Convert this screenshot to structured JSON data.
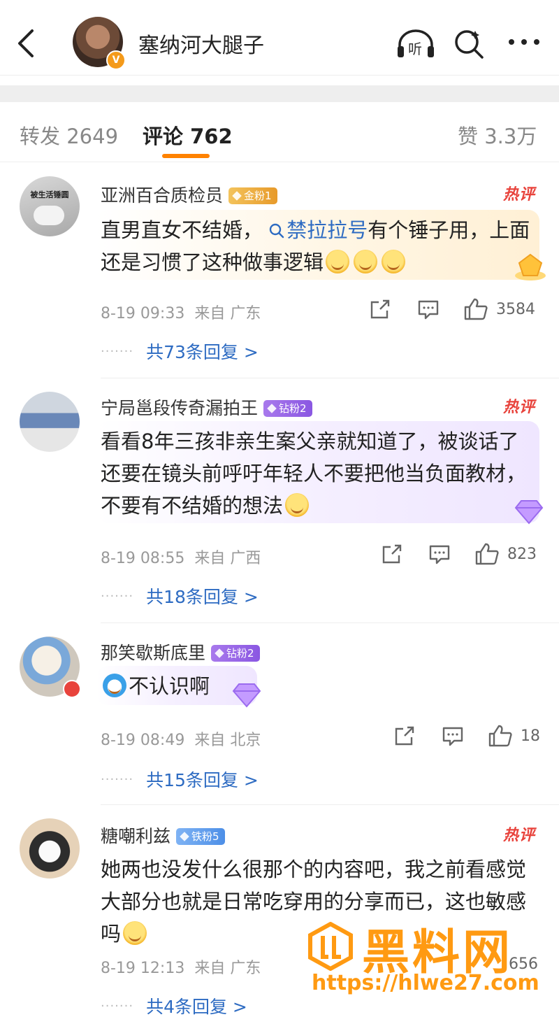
{
  "header": {
    "title": "塞纳河大腿子",
    "verified_badge": "V",
    "listen_label": "听",
    "icons": [
      "back-arrow-icon",
      "headphone-icon",
      "search-icon",
      "more-icon"
    ]
  },
  "tabs": [
    {
      "label": "转发 2649",
      "active": false
    },
    {
      "label": "评论 762",
      "active": true
    },
    {
      "label": "赞 3.3万",
      "active": false
    }
  ],
  "comments": [
    {
      "user": "亚洲百合质检员",
      "fan_badge": "金粉1",
      "fan_type": "gold",
      "hot_label": "热评",
      "avatar_caption": "被生活锤圆",
      "text_before": "直男直女不结婚，",
      "link": "禁拉拉号",
      "text_after": "有个锤子用，上面还是习惯了这种做事逻辑",
      "time": "8-19 09:33",
      "from": "来自 广东",
      "likes": "3584",
      "replies": "共73条回复 >"
    },
    {
      "user": "宁局邕段传奇漏拍王",
      "fan_badge": "钻粉2",
      "fan_type": "diamond",
      "hot_label": "热评",
      "text": "看看8年三孩非亲生案父亲就知道了，被谈话了还要在镜头前呼吁年轻人不要把他当负面教材，不要有不结婚的想法",
      "time": "8-19 08:55",
      "from": "来自 广西",
      "likes": "823",
      "replies": "共18条回复 >"
    },
    {
      "user": "那笑歇斯底里",
      "fan_badge": "钻粉2",
      "fan_type": "diamond",
      "text": "不认识啊",
      "time": "8-19 08:49",
      "from": "来自 北京",
      "likes": "18",
      "replies": "共15条回复 >"
    },
    {
      "user": "糖嘲利兹",
      "fan_badge": "铁粉5",
      "fan_type": "iron",
      "hot_label": "热评",
      "text": "她两也没发什么很那个的内容吧，我之前看感觉大部分也就是日常吃穿用的分享而已，这也敏感吗",
      "time": "8-19 12:13",
      "from": "来自 广东",
      "likes": "656",
      "replies": "共4条回复 >"
    }
  ],
  "watermark": {
    "name": "黑料网",
    "url": "https://hlwe27.com"
  },
  "colors": {
    "accent": "#ff8200",
    "link": "#2d6bc2",
    "hot": "#e8433c",
    "watermark": "#ff9a12"
  }
}
